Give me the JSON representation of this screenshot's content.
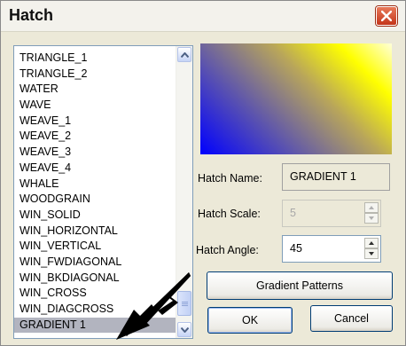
{
  "window": {
    "title": "Hatch",
    "close_icon": "close-x-icon"
  },
  "pattern_list": {
    "items": [
      "TRIANGLE_1",
      "TRIANGLE_2",
      "WATER",
      "WAVE",
      "WEAVE_1",
      "WEAVE_2",
      "WEAVE_3",
      "WEAVE_4",
      "WHALE",
      "WOODGRAIN",
      "WIN_SOLID",
      "WIN_HORIZONTAL",
      "WIN_VERTICAL",
      "WIN_FWDIAGONAL",
      "WIN_BKDIAGONAL",
      "WIN_CROSS",
      "WIN_DIAGCROSS",
      "GRADIENT 1"
    ],
    "selected": "GRADIENT 1"
  },
  "preview": {
    "gradient_from": "#0000ff",
    "gradient_to": "#ffff00"
  },
  "hatch_name": {
    "label": "Hatch Name:",
    "value": "GRADIENT 1"
  },
  "hatch_scale": {
    "label": "Hatch Scale:",
    "value": "5"
  },
  "hatch_angle": {
    "label": "Hatch Angle:",
    "value": "45"
  },
  "buttons": {
    "gradient_patterns": "Gradient Patterns",
    "ok": "OK",
    "cancel": "Cancel"
  },
  "annotation": {
    "arrow_color": "#000000"
  }
}
